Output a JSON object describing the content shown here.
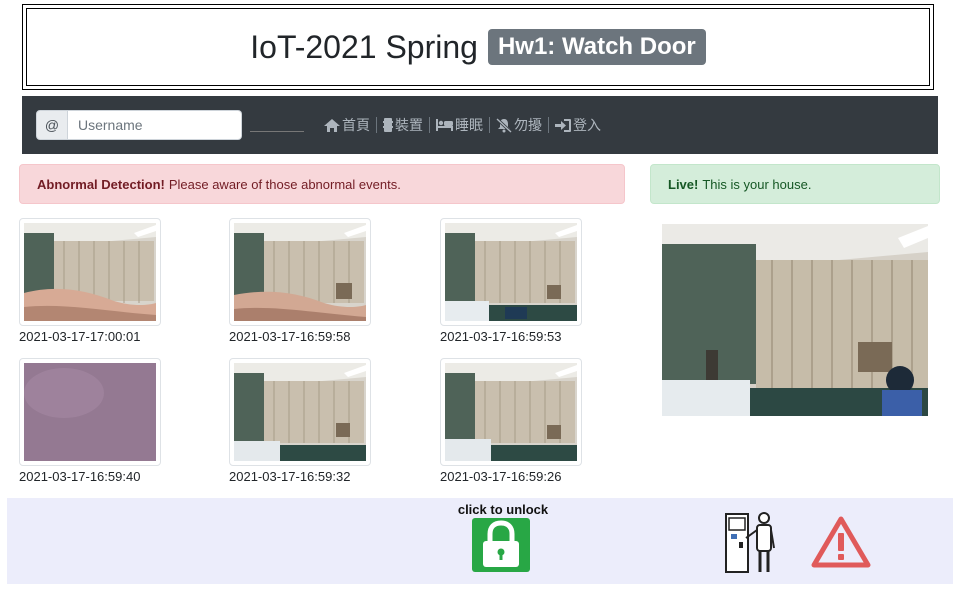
{
  "header": {
    "title": "IoT-2021 Spring",
    "badge": "Hw1: Watch Door"
  },
  "navbar": {
    "username_prefix": "@",
    "username_placeholder": "Username",
    "items": [
      {
        "icon": "home-icon",
        "label": "首頁"
      },
      {
        "icon": "device-icon",
        "label": "裝置"
      },
      {
        "icon": "bed-icon",
        "label": "睡眠"
      },
      {
        "icon": "bell-slash-icon",
        "label": "勿擾"
      },
      {
        "icon": "sign-in-icon",
        "label": "登入"
      }
    ]
  },
  "alerts": {
    "danger": {
      "title": "Abnormal Detection!",
      "text": "Please aware of those abnormal events."
    },
    "success": {
      "title": "Live!",
      "text": "This is your house."
    }
  },
  "gallery": [
    {
      "timestamp": "2021-03-17-17:00:01"
    },
    {
      "timestamp": "2021-03-17-16:59:58"
    },
    {
      "timestamp": "2021-03-17-16:59:53"
    },
    {
      "timestamp": "2021-03-17-16:59:40"
    },
    {
      "timestamp": "2021-03-17-16:59:32"
    },
    {
      "timestamp": "2021-03-17-16:59:26"
    }
  ],
  "footer": {
    "unlock_label": "click to unlock"
  },
  "colors": {
    "navbar": "#343a40",
    "danger_bg": "#f8d7da",
    "success_bg": "#d4edda",
    "unlock": "#28a745",
    "warning": "#e05a5a",
    "badge": "#6c757d"
  }
}
